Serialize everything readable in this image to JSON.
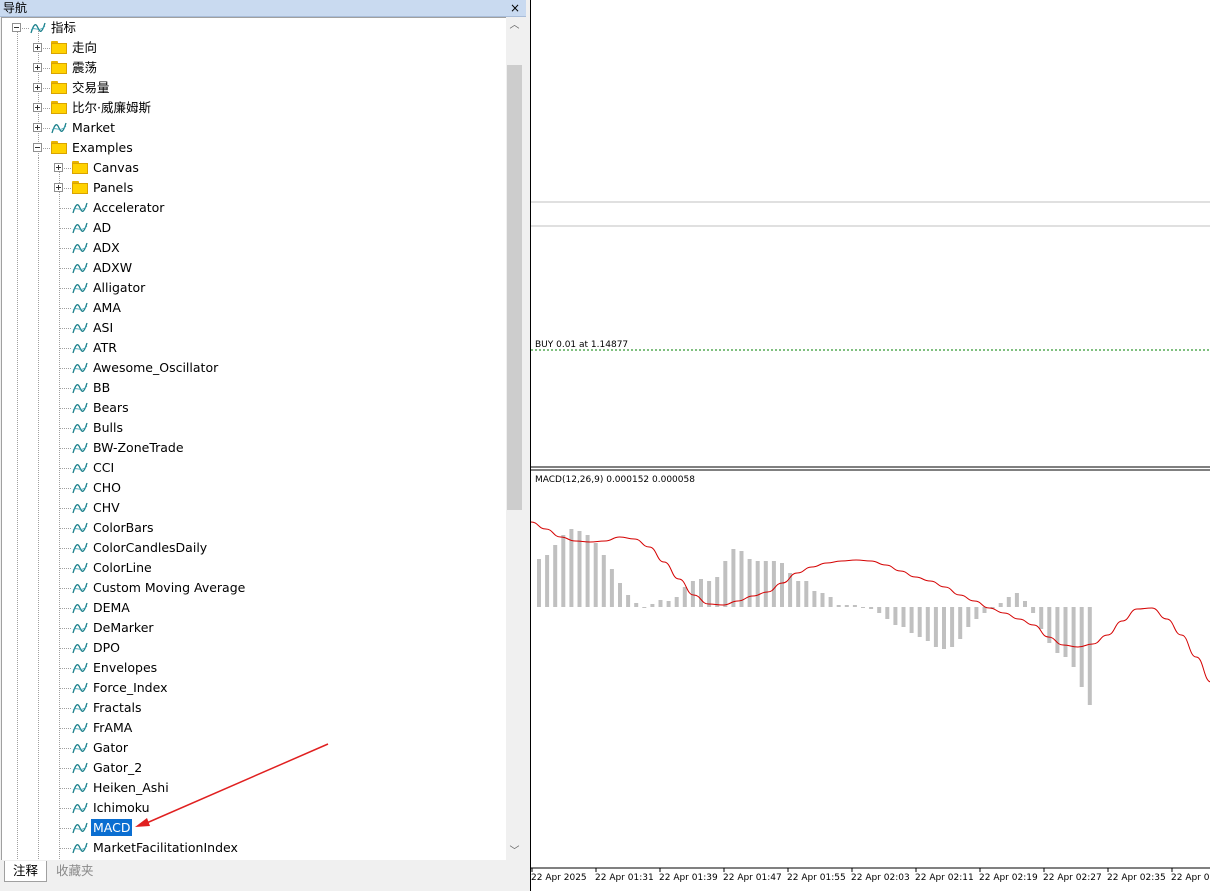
{
  "navigator": {
    "title": "导航",
    "close_glyph": "×",
    "tree": [
      {
        "label": "指标",
        "icon": "indicator-icon",
        "expander": "minus",
        "level": 0
      },
      {
        "label": "走向",
        "icon": "folder-icon",
        "expander": "plus",
        "level": 1
      },
      {
        "label": "震荡",
        "icon": "folder-icon",
        "expander": "plus",
        "level": 1
      },
      {
        "label": "交易量",
        "icon": "folder-icon",
        "expander": "plus",
        "level": 1
      },
      {
        "label": "比尔·威廉姆斯",
        "icon": "folder-icon",
        "expander": "plus",
        "level": 1
      },
      {
        "label": "Market",
        "icon": "indicator-icon",
        "expander": "plus",
        "level": 1
      },
      {
        "label": "Examples",
        "icon": "folder-icon",
        "expander": "minus",
        "level": 1
      },
      {
        "label": "Canvas",
        "icon": "folder-icon",
        "expander": "plus",
        "level": 2
      },
      {
        "label": "Panels",
        "icon": "folder-icon",
        "expander": "plus",
        "level": 2
      },
      {
        "label": "Accelerator",
        "icon": "indicator-icon",
        "level": 2
      },
      {
        "label": "AD",
        "icon": "indicator-icon",
        "level": 2
      },
      {
        "label": "ADX",
        "icon": "indicator-icon",
        "level": 2
      },
      {
        "label": "ADXW",
        "icon": "indicator-icon",
        "level": 2
      },
      {
        "label": "Alligator",
        "icon": "indicator-icon",
        "level": 2
      },
      {
        "label": "AMA",
        "icon": "indicator-icon",
        "level": 2
      },
      {
        "label": "ASI",
        "icon": "indicator-icon",
        "level": 2
      },
      {
        "label": "ATR",
        "icon": "indicator-icon",
        "level": 2
      },
      {
        "label": "Awesome_Oscillator",
        "icon": "indicator-icon",
        "level": 2
      },
      {
        "label": "BB",
        "icon": "indicator-icon",
        "level": 2
      },
      {
        "label": "Bears",
        "icon": "indicator-icon",
        "level": 2
      },
      {
        "label": "Bulls",
        "icon": "indicator-icon",
        "level": 2
      },
      {
        "label": "BW-ZoneTrade",
        "icon": "indicator-icon",
        "level": 2
      },
      {
        "label": "CCI",
        "icon": "indicator-icon",
        "level": 2
      },
      {
        "label": "CHO",
        "icon": "indicator-icon",
        "level": 2
      },
      {
        "label": "CHV",
        "icon": "indicator-icon",
        "level": 2
      },
      {
        "label": "ColorBars",
        "icon": "indicator-icon",
        "level": 2
      },
      {
        "label": "ColorCandlesDaily",
        "icon": "indicator-icon",
        "level": 2
      },
      {
        "label": "ColorLine",
        "icon": "indicator-icon",
        "level": 2
      },
      {
        "label": "Custom Moving Average",
        "icon": "indicator-icon",
        "level": 2
      },
      {
        "label": "DEMA",
        "icon": "indicator-icon",
        "level": 2
      },
      {
        "label": "DeMarker",
        "icon": "indicator-icon",
        "level": 2
      },
      {
        "label": "DPO",
        "icon": "indicator-icon",
        "level": 2
      },
      {
        "label": "Envelopes",
        "icon": "indicator-icon",
        "level": 2
      },
      {
        "label": "Force_Index",
        "icon": "indicator-icon",
        "level": 2
      },
      {
        "label": "Fractals",
        "icon": "indicator-icon",
        "level": 2
      },
      {
        "label": "FrAMA",
        "icon": "indicator-icon",
        "level": 2
      },
      {
        "label": "Gator",
        "icon": "indicator-icon",
        "level": 2
      },
      {
        "label": "Gator_2",
        "icon": "indicator-icon",
        "level": 2
      },
      {
        "label": "Heiken_Ashi",
        "icon": "indicator-icon",
        "level": 2
      },
      {
        "label": "Ichimoku",
        "icon": "indicator-icon",
        "level": 2
      },
      {
        "label": "MACD",
        "icon": "indicator-icon",
        "level": 2,
        "selected": true
      },
      {
        "label": "MarketFacilitationIndex",
        "icon": "indicator-icon",
        "level": 2
      }
    ],
    "tabs": [
      {
        "label": "注释",
        "active": true
      },
      {
        "label": "收藏夹",
        "active": false
      }
    ]
  },
  "chart": {
    "order_label": "BUY 0.01 at 1.14877",
    "macd_label": "MACD(12,26,9) 0.000152 0.000058",
    "time_labels": [
      "22 Apr 2025",
      "22 Apr 01:31",
      "22 Apr 01:39",
      "22 Apr 01:47",
      "22 Apr 01:55",
      "22 Apr 02:03",
      "22 Apr 02:11",
      "22 Apr 02:19",
      "22 Apr 02:27",
      "22 Apr 02:35",
      "22 Apr 0"
    ],
    "colors": {
      "histogram": "#c0c0c0",
      "signal": "#d40000",
      "order_line": "#008000",
      "selection": "#0a6ed1",
      "annotation_arrow": "#e02020"
    }
  },
  "chart_data": {
    "type": "bar",
    "title": "MACD(12,26,9) 0.000152 0.000058",
    "histogram": [
      0.48,
      0.52,
      0.62,
      0.72,
      0.78,
      0.76,
      0.72,
      0.64,
      0.52,
      0.38,
      0.24,
      0.12,
      0.04,
      -0.01,
      0.03,
      0.07,
      0.06,
      0.1,
      0.2,
      0.26,
      0.28,
      0.26,
      0.3,
      0.46,
      0.58,
      0.56,
      0.48,
      0.46,
      0.46,
      0.46,
      0.44,
      0.34,
      0.26,
      0.26,
      0.16,
      0.14,
      0.1,
      0.02,
      0.02,
      0.02,
      0.0,
      -0.02,
      -0.06,
      -0.12,
      -0.18,
      -0.2,
      -0.26,
      -0.3,
      -0.34,
      -0.4,
      -0.42,
      -0.4,
      -0.32,
      -0.2,
      -0.12,
      -0.06,
      -0.02,
      0.04,
      0.1,
      0.14,
      0.06,
      -0.06,
      -0.22,
      -0.36,
      -0.46,
      -0.5,
      -0.6,
      -0.8,
      -0.98
    ],
    "signal": [
      0.85,
      0.78,
      0.7,
      0.66,
      0.65,
      0.66,
      0.7,
      0.68,
      0.6,
      0.45,
      0.28,
      0.12,
      0.03,
      0.02,
      0.06,
      0.11,
      0.15,
      0.24,
      0.34,
      0.4,
      0.44,
      0.46,
      0.47,
      0.46,
      0.42,
      0.36,
      0.3,
      0.26,
      0.2,
      0.12,
      0.06,
      -0.01,
      -0.06,
      -0.12,
      -0.18,
      -0.3,
      -0.38,
      -0.4,
      -0.37,
      -0.28,
      -0.14,
      -0.02,
      -0.01,
      -0.12,
      -0.28,
      -0.5,
      -0.75
    ]
  }
}
